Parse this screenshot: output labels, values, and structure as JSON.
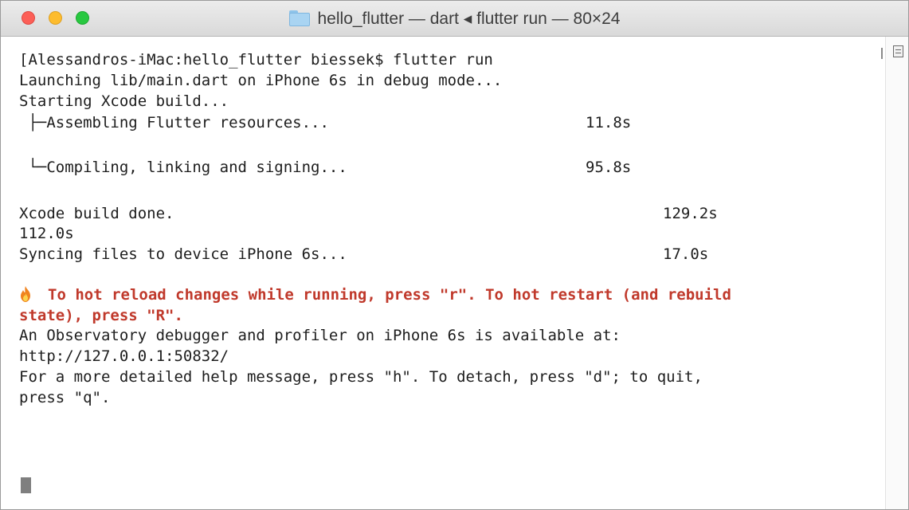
{
  "window": {
    "title": "hello_flutter — dart ◂ flutter run — 80×24"
  },
  "terminal": {
    "prompt_line": "[Alessandros-iMac:hello_flutter biessek$ flutter run",
    "launching": "Launching lib/main.dart on iPhone 6s in debug mode...",
    "starting": "Starting Xcode build...",
    "assembling": {
      "label": " ├─Assembling Flutter resources...",
      "time": "11.8s"
    },
    "compiling": {
      "label": " └─Compiling, linking and signing...",
      "time": "95.8s"
    },
    "xcode_done": {
      "label": "Xcode build done.",
      "time": "129.2s"
    },
    "extra_time": "112.0s",
    "syncing": {
      "label": "Syncing files to device iPhone 6s...",
      "time": "17.0s"
    },
    "hot_reload_1": "To hot reload changes while running, press \"r\". To hot restart (and rebuild",
    "hot_reload_2": "state), press \"R\".",
    "observatory_1": "An Observatory debugger and profiler on iPhone 6s is available at:",
    "observatory_2": "http://127.0.0.1:50832/",
    "help_1": "For a more detailed help message, press \"h\". To detach, press \"d\"; to quit,",
    "help_2": "press \"q\"."
  },
  "icons": {
    "flame": "flame-icon",
    "folder": "folder-icon"
  },
  "colors": {
    "warning_text": "#c0392b",
    "close": "#fc5f57",
    "minimize": "#fdbc2e",
    "maximize": "#28c840"
  }
}
